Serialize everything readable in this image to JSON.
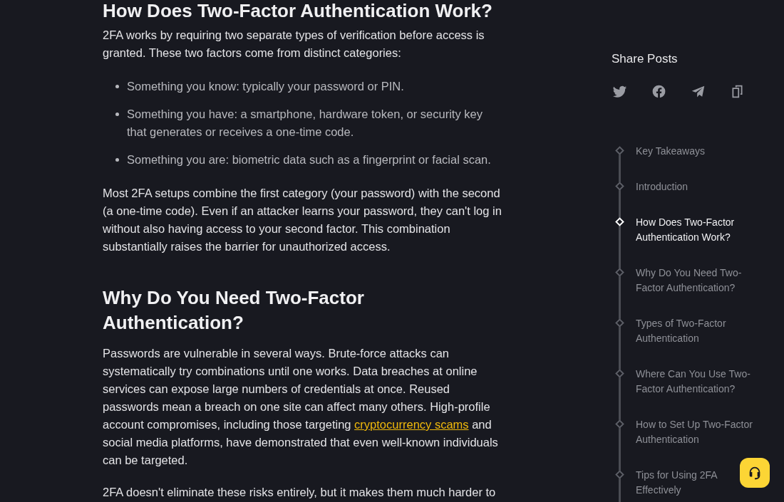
{
  "article": {
    "blocks": [
      {
        "kind": "heading",
        "text": "How Does Two-Factor Authentication Work?"
      },
      {
        "kind": "paragraph",
        "parts": [
          {
            "text": "2FA works by requiring two separate types of verification before access is granted. These two factors come from distinct categories:"
          }
        ]
      },
      {
        "kind": "list",
        "items": [
          "Something you know: typically your password or PIN.",
          "Something you have: a smartphone, hardware token, or security key that generates or receives a one-time code.",
          "Something you are: biometric data such as a fingerprint or facial scan."
        ]
      },
      {
        "kind": "paragraph",
        "parts": [
          {
            "text": "Most 2FA setups combine the first category (your password) with the second (a one-time code). Even if an attacker learns your password, they can't log in without also having access to your second factor. This combination substantially raises the barrier for unauthorized access."
          }
        ]
      },
      {
        "kind": "heading",
        "text": "Why Do You Need Two-Factor Authentication?"
      },
      {
        "kind": "paragraph",
        "parts": [
          {
            "text": "Passwords are vulnerable in several ways. Brute-force attacks can systematically try combinations until one works. Data breaches at online services can expose large numbers of credentials at once. Reused passwords mean a breach on one site can affect many others. High-profile account compromises, including those targeting "
          },
          {
            "text": "cryptocurrency scams",
            "kind": "link"
          },
          {
            "text": " and social media platforms, have demonstrated that even well-known individuals can be targeted."
          }
        ]
      },
      {
        "kind": "paragraph",
        "parts": [
          {
            "text": "2FA doesn't eliminate these risks entirely, but it makes them much harder to"
          }
        ]
      }
    ]
  },
  "share": {
    "title": "Share Posts",
    "buttons": [
      {
        "kind": "twitter"
      },
      {
        "kind": "facebook"
      },
      {
        "kind": "telegram"
      },
      {
        "kind": "copy"
      }
    ]
  },
  "toc": {
    "items": [
      {
        "label": "Key Takeaways",
        "selected": false
      },
      {
        "label": "Introduction",
        "selected": false
      },
      {
        "label": "How Does Two-Factor Authentication Work?",
        "selected": true
      },
      {
        "label": "Why Do You Need Two-Factor Authentication?",
        "selected": false
      },
      {
        "label": "Types of Two-Factor Authentication",
        "selected": false
      },
      {
        "label": "Where Can You Use Two-Factor Authentication?",
        "selected": false
      },
      {
        "label": "How to Set Up Two-Factor Authentication",
        "selected": false
      },
      {
        "label": "Tips for Using 2FA Effectively",
        "selected": false
      }
    ]
  }
}
